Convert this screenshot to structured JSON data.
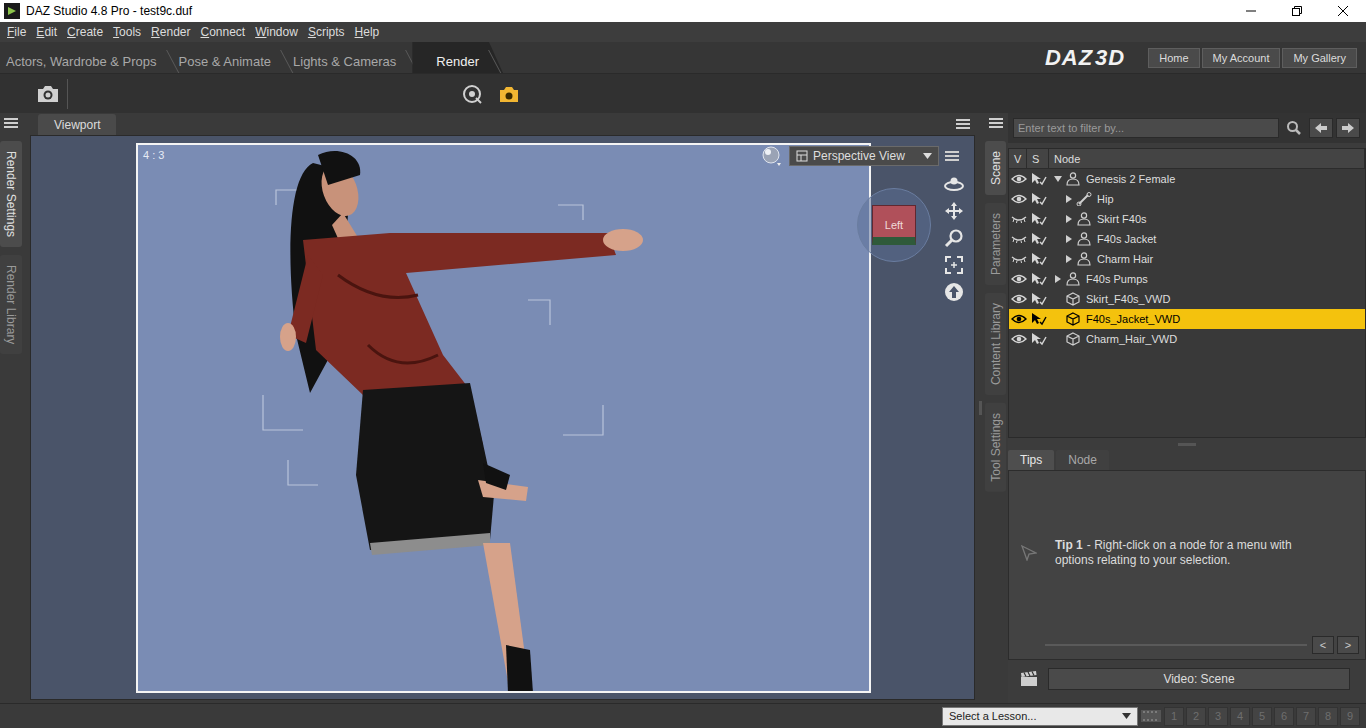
{
  "window": {
    "title": "DAZ Studio 4.8 Pro - test9c.duf"
  },
  "menu": [
    "File",
    "Edit",
    "Create",
    "Tools",
    "Render",
    "Connect",
    "Window",
    "Scripts",
    "Help"
  ],
  "room_tabs": [
    {
      "label": "Actors, Wardrobe & Props",
      "selected": false
    },
    {
      "label": "Pose & Animate",
      "selected": false
    },
    {
      "label": "Lights & Cameras",
      "selected": false
    },
    {
      "label": "Render",
      "selected": true
    }
  ],
  "logo": [
    "DAZ",
    "3D"
  ],
  "header_buttons": [
    "Home",
    "My Account",
    "My Gallery"
  ],
  "left_side_tabs": [
    {
      "label": "Render Settings",
      "selected": true
    },
    {
      "label": "Render Library",
      "selected": false
    }
  ],
  "viewport": {
    "tab": "Viewport",
    "aspect": "4 : 3",
    "view": "Perspective View",
    "cube_face": "Left"
  },
  "right_side_tabs": [
    {
      "label": "Scene",
      "selected": true
    },
    {
      "label": "Parameters",
      "selected": false
    },
    {
      "label": "Content Library",
      "selected": false
    },
    {
      "label": "Tool Settings",
      "selected": false
    }
  ],
  "scene": {
    "filter_placeholder": "Enter text to filter by...",
    "columns": [
      "V",
      "S",
      "Node"
    ],
    "rows": [
      {
        "name": "Genesis 2 Female",
        "depth": 0,
        "expandable": true,
        "expanded": true,
        "kind": "figure",
        "visible": true,
        "selected": false
      },
      {
        "name": "Hip",
        "depth": 1,
        "expandable": true,
        "expanded": false,
        "kind": "bone",
        "visible": true,
        "selected": false
      },
      {
        "name": "Skirt F40s",
        "depth": 1,
        "expandable": true,
        "expanded": false,
        "kind": "figure",
        "visible": false,
        "selected": false
      },
      {
        "name": "F40s Jacket",
        "depth": 1,
        "expandable": true,
        "expanded": false,
        "kind": "figure",
        "visible": false,
        "selected": false
      },
      {
        "name": "Charm Hair",
        "depth": 1,
        "expandable": true,
        "expanded": false,
        "kind": "figure",
        "visible": false,
        "selected": false
      },
      {
        "name": "F40s Pumps",
        "depth": 0,
        "expandable": true,
        "expanded": false,
        "kind": "figure",
        "visible": true,
        "selected": false
      },
      {
        "name": "Skirt_F40s_VWD",
        "depth": 0,
        "expandable": false,
        "expanded": false,
        "kind": "prop",
        "visible": true,
        "selected": false
      },
      {
        "name": "F40s_Jacket_VWD",
        "depth": 0,
        "expandable": false,
        "expanded": false,
        "kind": "prop",
        "visible": true,
        "selected": true
      },
      {
        "name": "Charm_Hair_VWD",
        "depth": 0,
        "expandable": false,
        "expanded": false,
        "kind": "prop",
        "visible": true,
        "selected": false
      }
    ]
  },
  "info_tabs": [
    {
      "label": "Tips",
      "selected": true
    },
    {
      "label": "Node",
      "selected": false
    }
  ],
  "tip": {
    "title": "Tip 1",
    "text": "- Right-click on a node for a menu with options relating to your selection."
  },
  "pager": [
    "<",
    ">"
  ],
  "video_button": "Video: Scene",
  "status_bar": {
    "lesson_placeholder": "Select a Lesson...",
    "lessons": [
      {
        "label": "1",
        "enabled": false
      },
      {
        "label": "2",
        "enabled": false
      },
      {
        "label": "3",
        "enabled": false
      },
      {
        "label": "4",
        "enabled": false
      },
      {
        "label": "5",
        "enabled": false
      },
      {
        "label": "6",
        "enabled": false
      },
      {
        "label": "7",
        "enabled": false
      },
      {
        "label": "8",
        "enabled": false
      },
      {
        "label": "9",
        "enabled": false
      }
    ]
  }
}
